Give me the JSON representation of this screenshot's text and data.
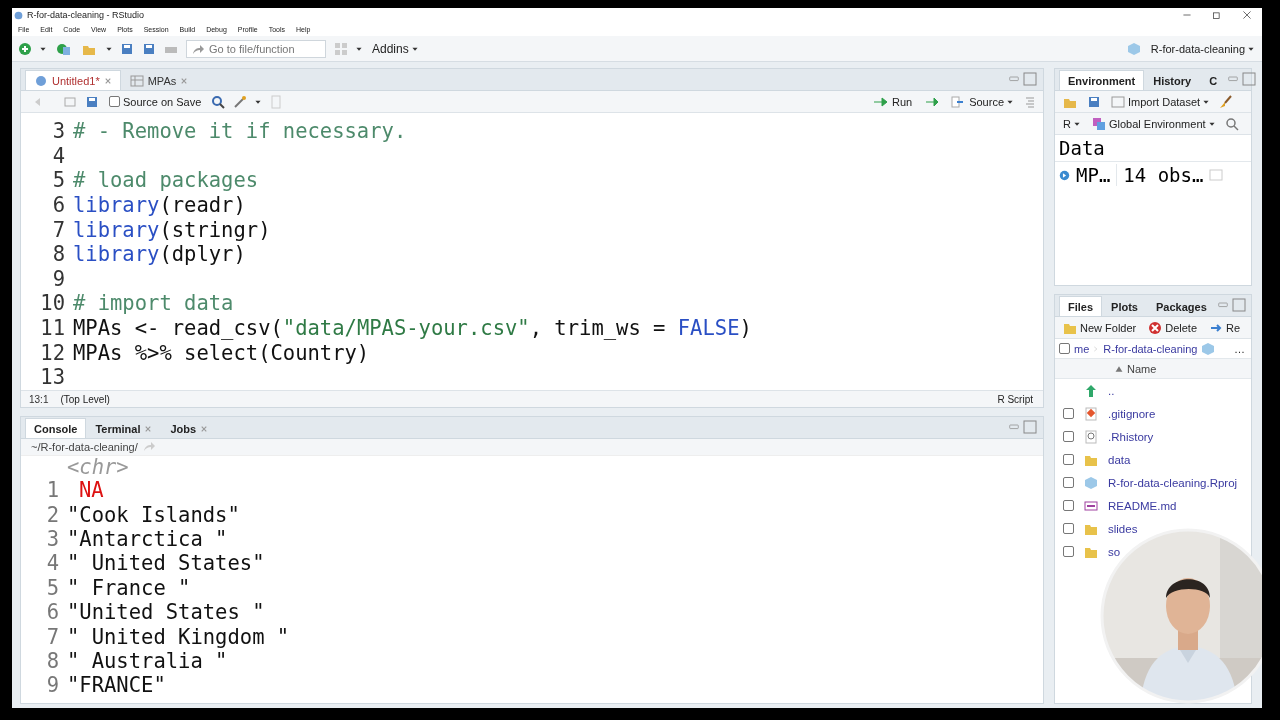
{
  "window": {
    "title": "R-for-data-cleaning - RStudio"
  },
  "menu": [
    "File",
    "Edit",
    "Code",
    "View",
    "Plots",
    "Session",
    "Build",
    "Debug",
    "Profile",
    "Tools",
    "Help"
  ],
  "toolbar": {
    "goto_placeholder": "Go to file/function",
    "addins": "Addins",
    "project": "R-for-data-cleaning"
  },
  "editor": {
    "tabs": [
      {
        "label": "Untitled1*",
        "selected": true,
        "kind": "script"
      },
      {
        "label": "MPAs",
        "selected": false,
        "kind": "data"
      }
    ],
    "source_on_save": {
      "label": "Source on Save",
      "checked": false
    },
    "run": "Run",
    "source": "Source",
    "lines": [
      {
        "number": "3",
        "tokens": [
          {
            "text": "# - Remove it if necessary.",
            "kind": "comment"
          }
        ]
      },
      {
        "number": "4"
      },
      {
        "number": "5",
        "tokens": [
          {
            "text": "# load packages",
            "kind": "comment"
          }
        ]
      },
      {
        "number": "6",
        "tokens": [
          {
            "text": "library",
            "kind": "fn"
          },
          {
            "text": "(readr)",
            "kind": "plain"
          }
        ]
      },
      {
        "number": "7",
        "tokens": [
          {
            "text": "library",
            "kind": "fn"
          },
          {
            "text": "(stringr)",
            "kind": "plain"
          }
        ]
      },
      {
        "number": "8",
        "tokens": [
          {
            "text": "library",
            "kind": "fn"
          },
          {
            "text": "(dplyr)",
            "kind": "plain"
          }
        ]
      },
      {
        "number": "9"
      },
      {
        "number": "10",
        "tokens": [
          {
            "text": "# import data",
            "kind": "comment"
          }
        ]
      },
      {
        "number": "11",
        "tokens": [
          {
            "text": "MPAs <- read_csv(",
            "kind": "plain"
          },
          {
            "text": "\"data/MPAS-your.csv\"",
            "kind": "string"
          },
          {
            "text": ", trim_ws = ",
            "kind": "plain"
          },
          {
            "text": "FALSE",
            "kind": "const"
          },
          {
            "text": ")",
            "kind": "plain"
          }
        ]
      },
      {
        "number": "12",
        "tokens": [
          {
            "text": "MPAs %>% select(Country)",
            "kind": "plain"
          }
        ]
      },
      {
        "number": "13"
      }
    ],
    "status": {
      "position": "13:1",
      "scope": "(Top Level)",
      "type": "R Script"
    }
  },
  "console": {
    "tabs": [
      {
        "label": "Console",
        "selected": true,
        "closable": false
      },
      {
        "label": "Terminal",
        "selected": false,
        "closable": true
      },
      {
        "label": "Jobs",
        "selected": false,
        "closable": true
      }
    ],
    "path": "~/R-for-data-cleaning/",
    "type_row": "<chr>",
    "rows": [
      {
        "index": "1",
        "value": "NA",
        "na": true
      },
      {
        "index": "2",
        "value": "\"Cook Islands\"",
        "na": false
      },
      {
        "index": "3",
        "value": "\"Antarctica \"",
        "na": false
      },
      {
        "index": "4",
        "value": "\" United States\"",
        "na": false
      },
      {
        "index": "5",
        "value": "\" France \"",
        "na": false
      },
      {
        "index": "6",
        "value": "\"United States \"",
        "na": false
      },
      {
        "index": "7",
        "value": "\" United Kingdom \"",
        "na": false
      },
      {
        "index": "8",
        "value": "\" Australia \"",
        "na": false
      },
      {
        "index": "9",
        "value": "\"FRANCE\"",
        "na": false
      }
    ]
  },
  "environment": {
    "tabs": [
      {
        "label": "Environment",
        "selected": true
      },
      {
        "label": "History",
        "selected": false
      },
      {
        "label": "C",
        "selected": false
      }
    ],
    "import": "Import Dataset",
    "language": "R",
    "scope": "Global Environment",
    "section": "Data",
    "items": [
      {
        "name": "MP…",
        "value": "14 obs…"
      }
    ]
  },
  "files": {
    "tabs": [
      {
        "label": "Files",
        "selected": true
      },
      {
        "label": "Plots",
        "selected": false
      },
      {
        "label": "Packages",
        "selected": false
      }
    ],
    "all_checked": false,
    "new_folder": "New Folder",
    "delete": "Delete",
    "rename": "Re",
    "path": [
      "me",
      "R-for-data-cleaning"
    ],
    "more": "…",
    "column": "Name",
    "items": [
      {
        "name": "..",
        "kind": "up"
      },
      {
        "name": ".gitignore",
        "kind": "git",
        "checked": false
      },
      {
        "name": ".Rhistory",
        "kind": "history",
        "checked": false
      },
      {
        "name": "data",
        "kind": "folder",
        "checked": false
      },
      {
        "name": "R-for-data-cleaning.Rproj",
        "kind": "project",
        "checked": false
      },
      {
        "name": "README.md",
        "kind": "markdown",
        "checked": false
      },
      {
        "name": "slides",
        "kind": "folder",
        "checked": false
      },
      {
        "name": "so",
        "kind": "folder",
        "checked": false
      }
    ]
  }
}
